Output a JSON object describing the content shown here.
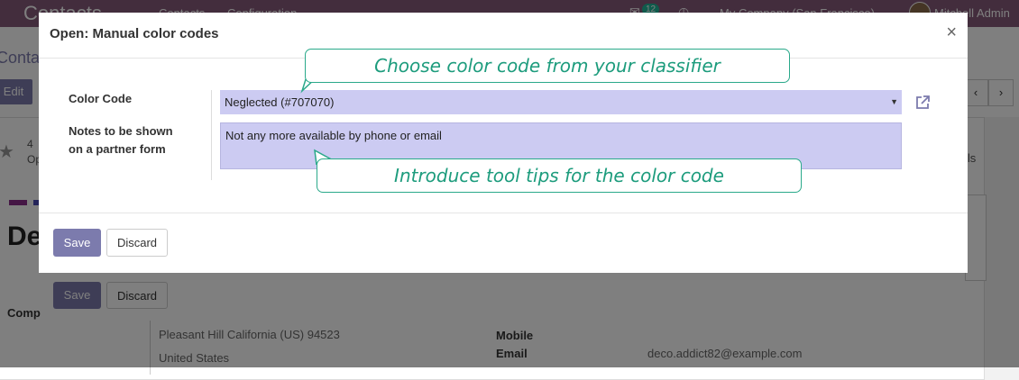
{
  "background": {
    "navbar": {
      "brand": "Contacts",
      "links": [
        "Contacts",
        "Configuration"
      ],
      "badge": "12",
      "company": "My Company (San Francisco)",
      "user": "Mitchell Admin"
    },
    "breadcrumb": "Conta",
    "edit_button": "Edit",
    "pager": {
      "prev": "‹",
      "next": "›"
    },
    "smart_button": {
      "count": "4",
      "label": "Op"
    },
    "smart_button_right": "lls",
    "contact_name": "De",
    "company_label": "Comp",
    "address_line1": "Pleasant Hill  California (US)  94523",
    "address_line2": "United States",
    "mobile_label": "Mobile",
    "email_label": "Email",
    "email_value": "deco.addict82@example.com",
    "save_label": "Save",
    "discard_label": "Discard"
  },
  "modal": {
    "title": "Open: Manual color codes",
    "close_symbol": "×",
    "color_code_label": "Color Code",
    "color_code_value": "Neglected (#707070)",
    "notes_label_line1": "Notes to be shown",
    "notes_label_line2": "on a partner form",
    "notes_value": "Not any more available by phone or email",
    "save_label": "Save",
    "discard_label": "Discard"
  },
  "tooltips": {
    "top": "Choose color code from your classifier",
    "bottom": "Introduce tool tips for the color code"
  },
  "colors": {
    "brand": "#875a7b",
    "primary_button": "#7c7bad",
    "field_background": "#cccbf2",
    "tooltip_accent": "#2aa98a"
  }
}
